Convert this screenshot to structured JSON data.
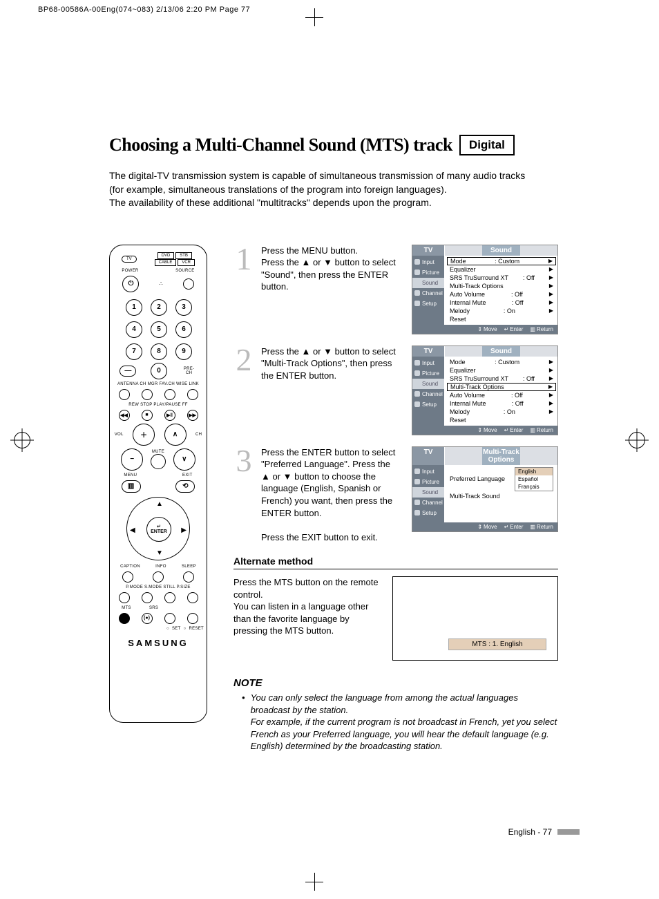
{
  "header": "BP68-00586A-00Eng(074~083)  2/13/06  2:20 PM  Page 77",
  "title": "Choosing a Multi-Channel Sound (MTS) track",
  "badge": "Digital",
  "intro_l1": "The digital-TV transmission system is capable of simultaneous transmission of many audio tracks",
  "intro_l2": "(for example, simultaneous translations of the program into foreign languages).",
  "intro_l3": "The availability of these additional \"multitracks\" depends upon the program.",
  "remote": {
    "tv": "TV",
    "dvd": "DVD",
    "stb": "STB",
    "cable": "CABLE",
    "vcr": "VCR",
    "power": "POWER",
    "source": "SOURCE",
    "prech": "PRE-CH",
    "row_labels": "ANTENNA  CH MGR  FAV.CH  WISE LINK",
    "transport": "REW   STOP   PLAY/PAUSE   FF",
    "vol": "VOL",
    "ch": "CH",
    "mute": "MUTE",
    "menu": "MENU",
    "exit": "EXIT",
    "enter_top": "↵",
    "enter": "ENTER",
    "caption": "CAPTION",
    "info": "INFO",
    "sleep": "SLEEP",
    "row2": "P.MODE  S.MODE  STILL   P.SIZE",
    "mts": "MTS",
    "srs": "SRS",
    "set": "SET",
    "reset": "RESET",
    "brand": "SAMSUNG"
  },
  "steps": [
    {
      "n": "1",
      "body": "Press the MENU button.\nPress the ▲ or ▼ button to select \"Sound\", then press the ENTER button.",
      "osd_type": "sound",
      "highlight": ""
    },
    {
      "n": "2",
      "body": "Press the ▲ or ▼ button to select \"Multi-Track Options\", then press the ENTER button.",
      "osd_type": "sound",
      "highlight": "multitrack"
    },
    {
      "n": "3",
      "body": "Press the ENTER button to select \"Preferred Language\". Press the ▲ or ▼ button to choose the language (English, Spanish or French) you want, then press the ENTER button.\n\nPress the EXIT button to exit.",
      "osd_type": "mto"
    }
  ],
  "osd": {
    "tv": "TV",
    "sound_title": "Sound",
    "mto_title": "Multi-Track Options",
    "side": [
      "Input",
      "Picture",
      "Sound",
      "Channel",
      "Setup"
    ],
    "sound_items": [
      {
        "label": "Mode",
        "val": ": Custom",
        "arrow": true
      },
      {
        "label": "Equalizer",
        "val": "",
        "arrow": true
      },
      {
        "label": "SRS TruSurround XT",
        "val": ": Off",
        "arrow": true
      },
      {
        "label": "Multi-Track Options",
        "val": "",
        "arrow": true
      },
      {
        "label": "Auto Volume",
        "val": ": Off",
        "arrow": true
      },
      {
        "label": "Internal Mute",
        "val": ": Off",
        "arrow": true
      },
      {
        "label": "Melody",
        "val": ": On",
        "arrow": true
      },
      {
        "label": "Reset",
        "val": "",
        "arrow": false
      }
    ],
    "mto_items": [
      {
        "label": "Preferred Language"
      },
      {
        "label": "Multi-Track Sound"
      }
    ],
    "languages": [
      "English",
      "Español",
      "Français"
    ],
    "foot_move": "Move",
    "foot_enter": "Enter",
    "foot_return": "Return"
  },
  "alt": {
    "heading": "Alternate method",
    "body": "Press the MTS button on the remote control.\nYou can listen in a language other than the favorite language by pressing the MTS button.",
    "bar": "MTS : 1. English"
  },
  "note": {
    "heading": "NOTE",
    "bullet": "•",
    "body": "You can only select the language from among the actual languages broadcast by the station.\nFor example, if the current program is not broadcast in French, yet you select French as your Preferred language, you will hear the default language (e.g. English) determined by the broadcasting station."
  },
  "footer": "English - 77"
}
